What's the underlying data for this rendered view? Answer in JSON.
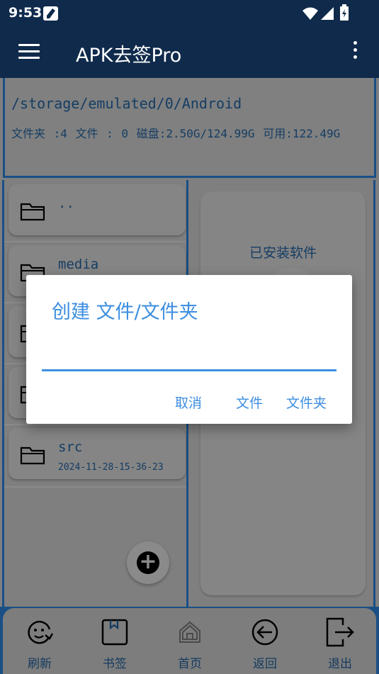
{
  "status": {
    "time": "9:53"
  },
  "app": {
    "title": "APK去签Pro"
  },
  "path_panel": {
    "path": "/storage/emulated/0/Android",
    "info": "文件夹 :4   文件 : 0   磁盘:2.50G/124.99G  可用:122.49G"
  },
  "file_list": {
    "items": [
      {
        "name": "..",
        "date": ""
      },
      {
        "name": "media",
        "date": ""
      },
      {
        "name": "",
        "date": ""
      },
      {
        "name": "",
        "date": ""
      },
      {
        "name": "src",
        "date": "2024-11-28-15-36-23"
      }
    ]
  },
  "installed_panel": {
    "label": "已安装软件"
  },
  "dialog": {
    "title": "创建 文件/文件夹",
    "input_value": "",
    "cancel_label": "取消",
    "file_label": "文件",
    "folder_label": "文件夹"
  },
  "bottom_nav": {
    "items": [
      {
        "label": "刷新",
        "icon": "refresh-smile-icon"
      },
      {
        "label": "书签",
        "icon": "bookmark-icon"
      },
      {
        "label": "首页",
        "icon": "home-icon"
      },
      {
        "label": "返回",
        "icon": "back-arrow-icon"
      },
      {
        "label": "退出",
        "icon": "exit-icon"
      }
    ]
  },
  "colors": {
    "accent": "#3d8ee0",
    "appbar": "#0f2a4b",
    "border_blue": "#1a4f86",
    "scrim": "#7f7f7f"
  }
}
